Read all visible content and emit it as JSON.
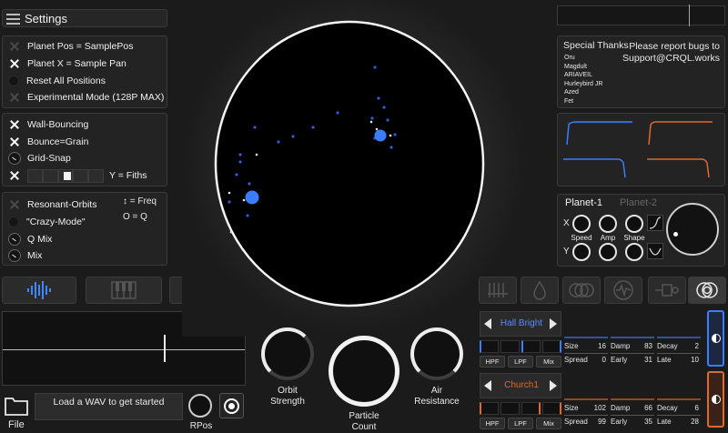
{
  "header": {
    "title": "Settings",
    "menu_icon": "hamburger-icon"
  },
  "group1": [
    {
      "label": "Planet Pos = SamplePos",
      "state": "off"
    },
    {
      "label": "Planet X = Sample Pan",
      "state": "on"
    },
    {
      "label": "Reset All Positions",
      "state": "dot"
    },
    {
      "label": "Experimental Mode (128P MAX)",
      "state": "off"
    }
  ],
  "group2": {
    "wall": "Wall-Bouncing",
    "bounce": "Bounce=Grain",
    "grid": "Grid-Snap",
    "fiths": "Y = Fiths"
  },
  "group3": {
    "resonant": "Resonant-Orbits",
    "crazy": "\"Crazy-Mode\"",
    "qmix": "Q Mix",
    "mix": "Mix",
    "freq": "↕ = Freq",
    "oq": "O = Q"
  },
  "credits": {
    "title": "Special Thanks",
    "names": [
      "Oru",
      "Magdult",
      "ARIAVEIL",
      "Hurleybird JR",
      "Azed",
      "Fet"
    ],
    "report_line1": "Please report bugs to",
    "report_line2": "Support@CRQL.works"
  },
  "planet_panel": {
    "active_tab": "Planet-1",
    "inactive_tab": "Planet-2",
    "x_label": "X",
    "y_label": "Y",
    "speed": "Speed",
    "amp": "Amp",
    "shape": "Shape"
  },
  "bottom": {
    "load_wav": "Load a WAV to get started",
    "file": "File",
    "rpos": "RPos",
    "orbit_strength_1": "Orbit",
    "orbit_strength_2": "Strength",
    "particle_count_1": "Particle",
    "particle_count_2": "Count",
    "air_resistance_1": "Air",
    "air_resistance_2": "Resistance"
  },
  "reverb1": {
    "preset": "Hall Bright",
    "color": "#5b8cff",
    "hpf": "HPF",
    "lpf": "LPF",
    "mix": "Mix",
    "size_label": "Size",
    "size": "16",
    "damp_label": "Damp",
    "damp": "83",
    "decay_label": "Decay",
    "decay": "2",
    "spread_label": "Spread",
    "spread": "0",
    "early_label": "Early",
    "early": "31",
    "late_label": "Late",
    "late": "10"
  },
  "reverb2": {
    "preset": "Church1",
    "color": "#e0692d",
    "hpf": "HPF",
    "lpf": "LPF",
    "mix": "Mix",
    "size_label": "Size",
    "size": "102",
    "damp_label": "Damp",
    "damp": "66",
    "decay_label": "Decay",
    "decay": "6",
    "spread_label": "Spread",
    "spread": "99",
    "early_label": "Early",
    "early": "35",
    "late_label": "Late",
    "late": "28"
  },
  "colors": {
    "blue": "#3a7dff",
    "orange": "#e06a2a",
    "bg": "#1b1b1b"
  }
}
